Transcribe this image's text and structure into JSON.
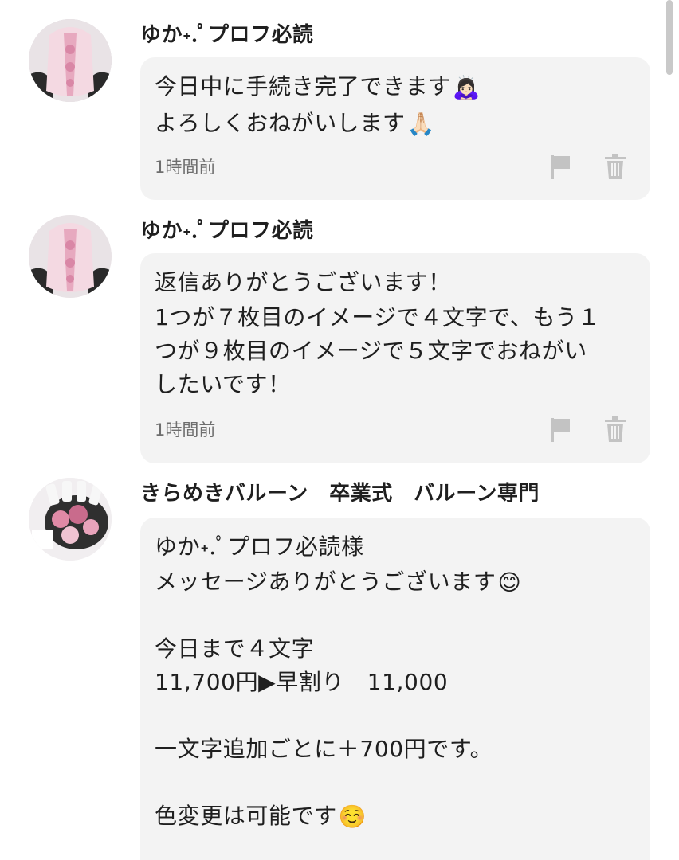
{
  "icons": {
    "flag": "flag-icon",
    "trash": "trash-icon",
    "avatar_user": "avatar-photo",
    "avatar_shop": "avatar-photo"
  },
  "colors": {
    "bubble_bg": "#f3f3f3",
    "icon_gray": "#c3c3c3",
    "timestamp_gray": "#6e6e6e"
  },
  "comments": [
    {
      "username": "ゆか˖.ﾟプロフ必読",
      "lines": [
        "今日中に手続き完了できます",
        "よろしくおねがいします"
      ],
      "emojis": [
        "🙇🏻‍♀️",
        "🙏🏻"
      ],
      "timestamp": "1時間前"
    },
    {
      "username": "ゆか˖.ﾟプロフ必読",
      "lines": [
        "返信ありがとうございます！",
        "1つが７枚目のイメージで４文字で、もう１",
        "つが９枚目のイメージで５文字でおねがい",
        "したいです！"
      ],
      "timestamp": "1時間前"
    },
    {
      "username": "きらめきバルーン　卒業式　バルーン専門",
      "lines": [
        "ゆか˖.ﾟプロフ必読様",
        "メッセージありがとうございます",
        "",
        "今日まで４文字",
        "11,700円▶早割り　11,000",
        "",
        "一文字追加ごとに＋700円です。",
        "",
        "色変更は可能です"
      ],
      "emojis": [
        "😊",
        "☺️"
      ]
    }
  ]
}
